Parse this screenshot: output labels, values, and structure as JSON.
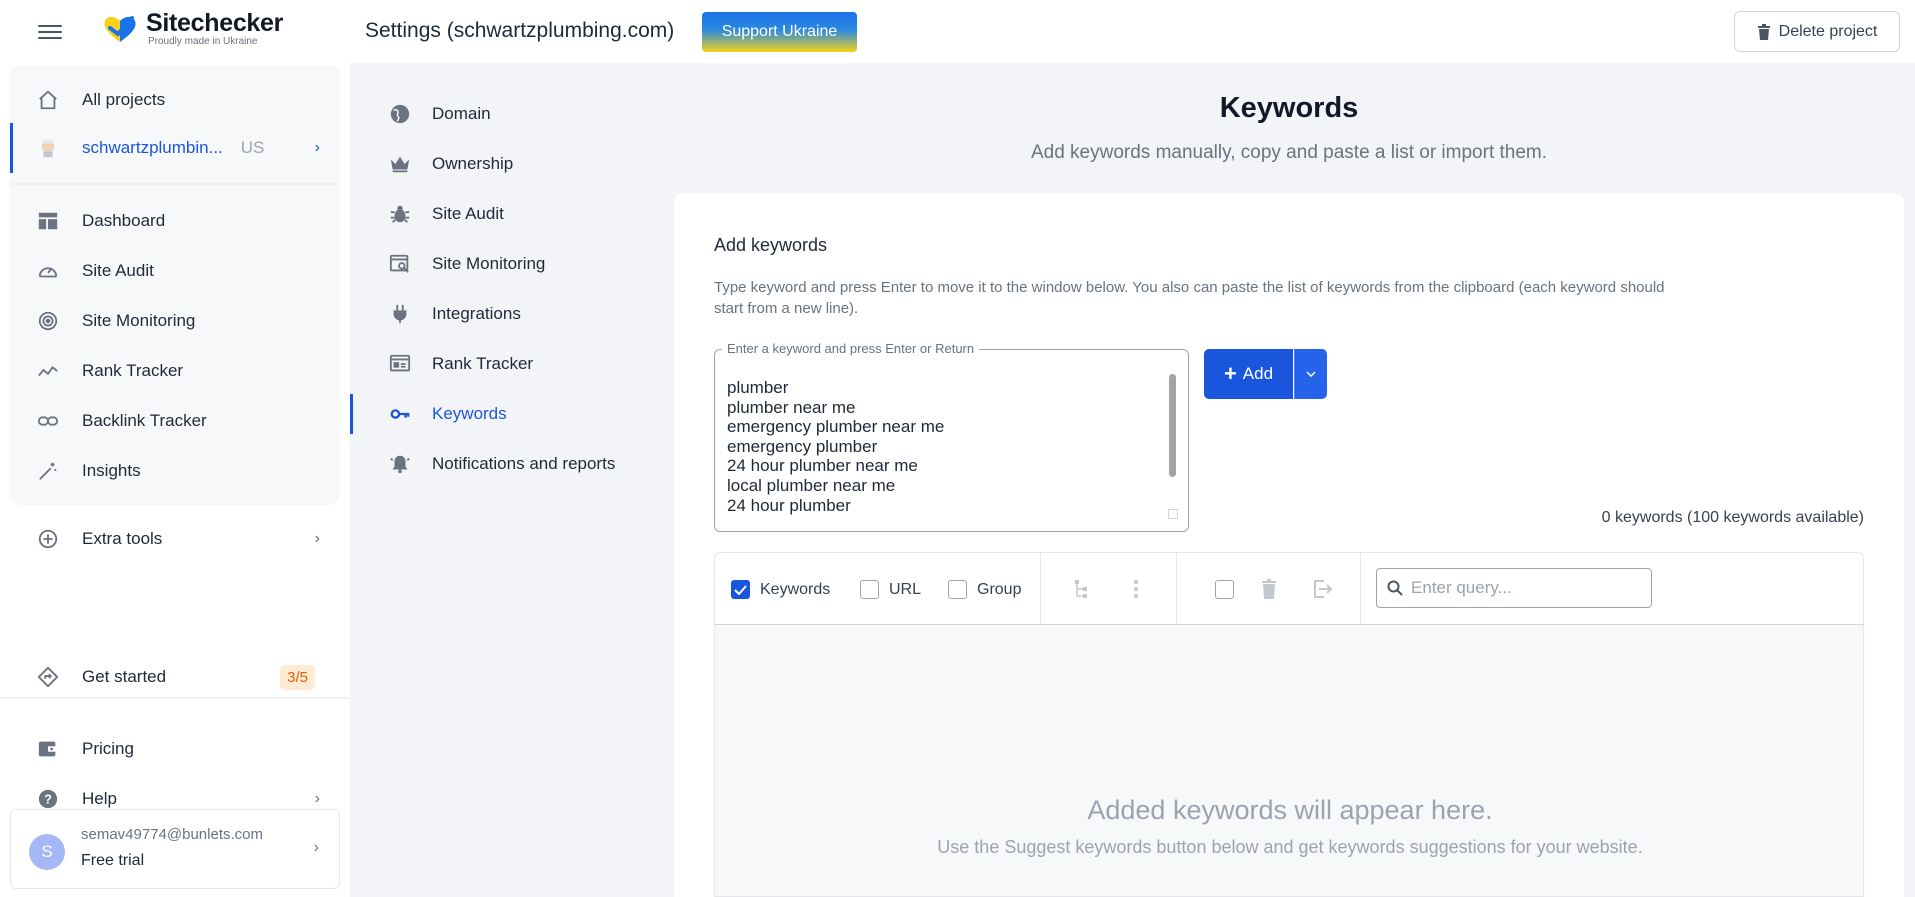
{
  "app": {
    "logo_name": "Sitechecker",
    "logo_sub": "Proudly made in Ukraine",
    "page_heading": "Settings (schwartzplumbing.com)",
    "support_label": "Support Ukraine",
    "delete_label": "Delete project"
  },
  "sidebar": {
    "all_projects": "All projects",
    "project_name": "schwartzplumbin...",
    "project_country": "US",
    "items": [
      {
        "label": "Dashboard"
      },
      {
        "label": "Site Audit"
      },
      {
        "label": "Site Monitoring"
      },
      {
        "label": "Rank Tracker"
      },
      {
        "label": "Backlink Tracker"
      },
      {
        "label": "Insights"
      }
    ],
    "extra_tools": "Extra tools",
    "get_started": "Get started",
    "get_started_badge": "3/5",
    "pricing": "Pricing",
    "help": "Help",
    "user_initial": "S",
    "user_email": "semav49774@bunlets.com",
    "user_plan": "Free trial"
  },
  "settings_nav": {
    "items": [
      {
        "label": "Domain"
      },
      {
        "label": "Ownership"
      },
      {
        "label": "Site Audit"
      },
      {
        "label": "Site Monitoring"
      },
      {
        "label": "Integrations"
      },
      {
        "label": "Rank Tracker"
      },
      {
        "label": "Keywords"
      },
      {
        "label": "Notifications and reports"
      }
    ]
  },
  "main": {
    "title": "Keywords",
    "subtitle": "Add keywords manually, copy and paste a list or import them.",
    "section_heading": "Add keywords",
    "hint": "Type keyword and press Enter to move it to the window below. You also can paste the list of keywords from the clipboard (each keyword should start from a new line).",
    "input_legend": "Enter a keyword and press Enter or Return",
    "input_value": "plumber\nplumber near me\nemergency plumber near me\nemergency plumber\n24 hour plumber near me\nlocal plumber near me\n24 hour plumber",
    "add_label": "Add",
    "keyword_count": "0 keywords (100 keywords available)",
    "filters": {
      "keywords": "Keywords",
      "url": "URL",
      "group": "Group"
    },
    "search_placeholder": "Enter query...",
    "empty_title": "Added keywords will appear here.",
    "empty_subtitle": "Use the Suggest keywords button below and get keywords suggestions for your website."
  }
}
